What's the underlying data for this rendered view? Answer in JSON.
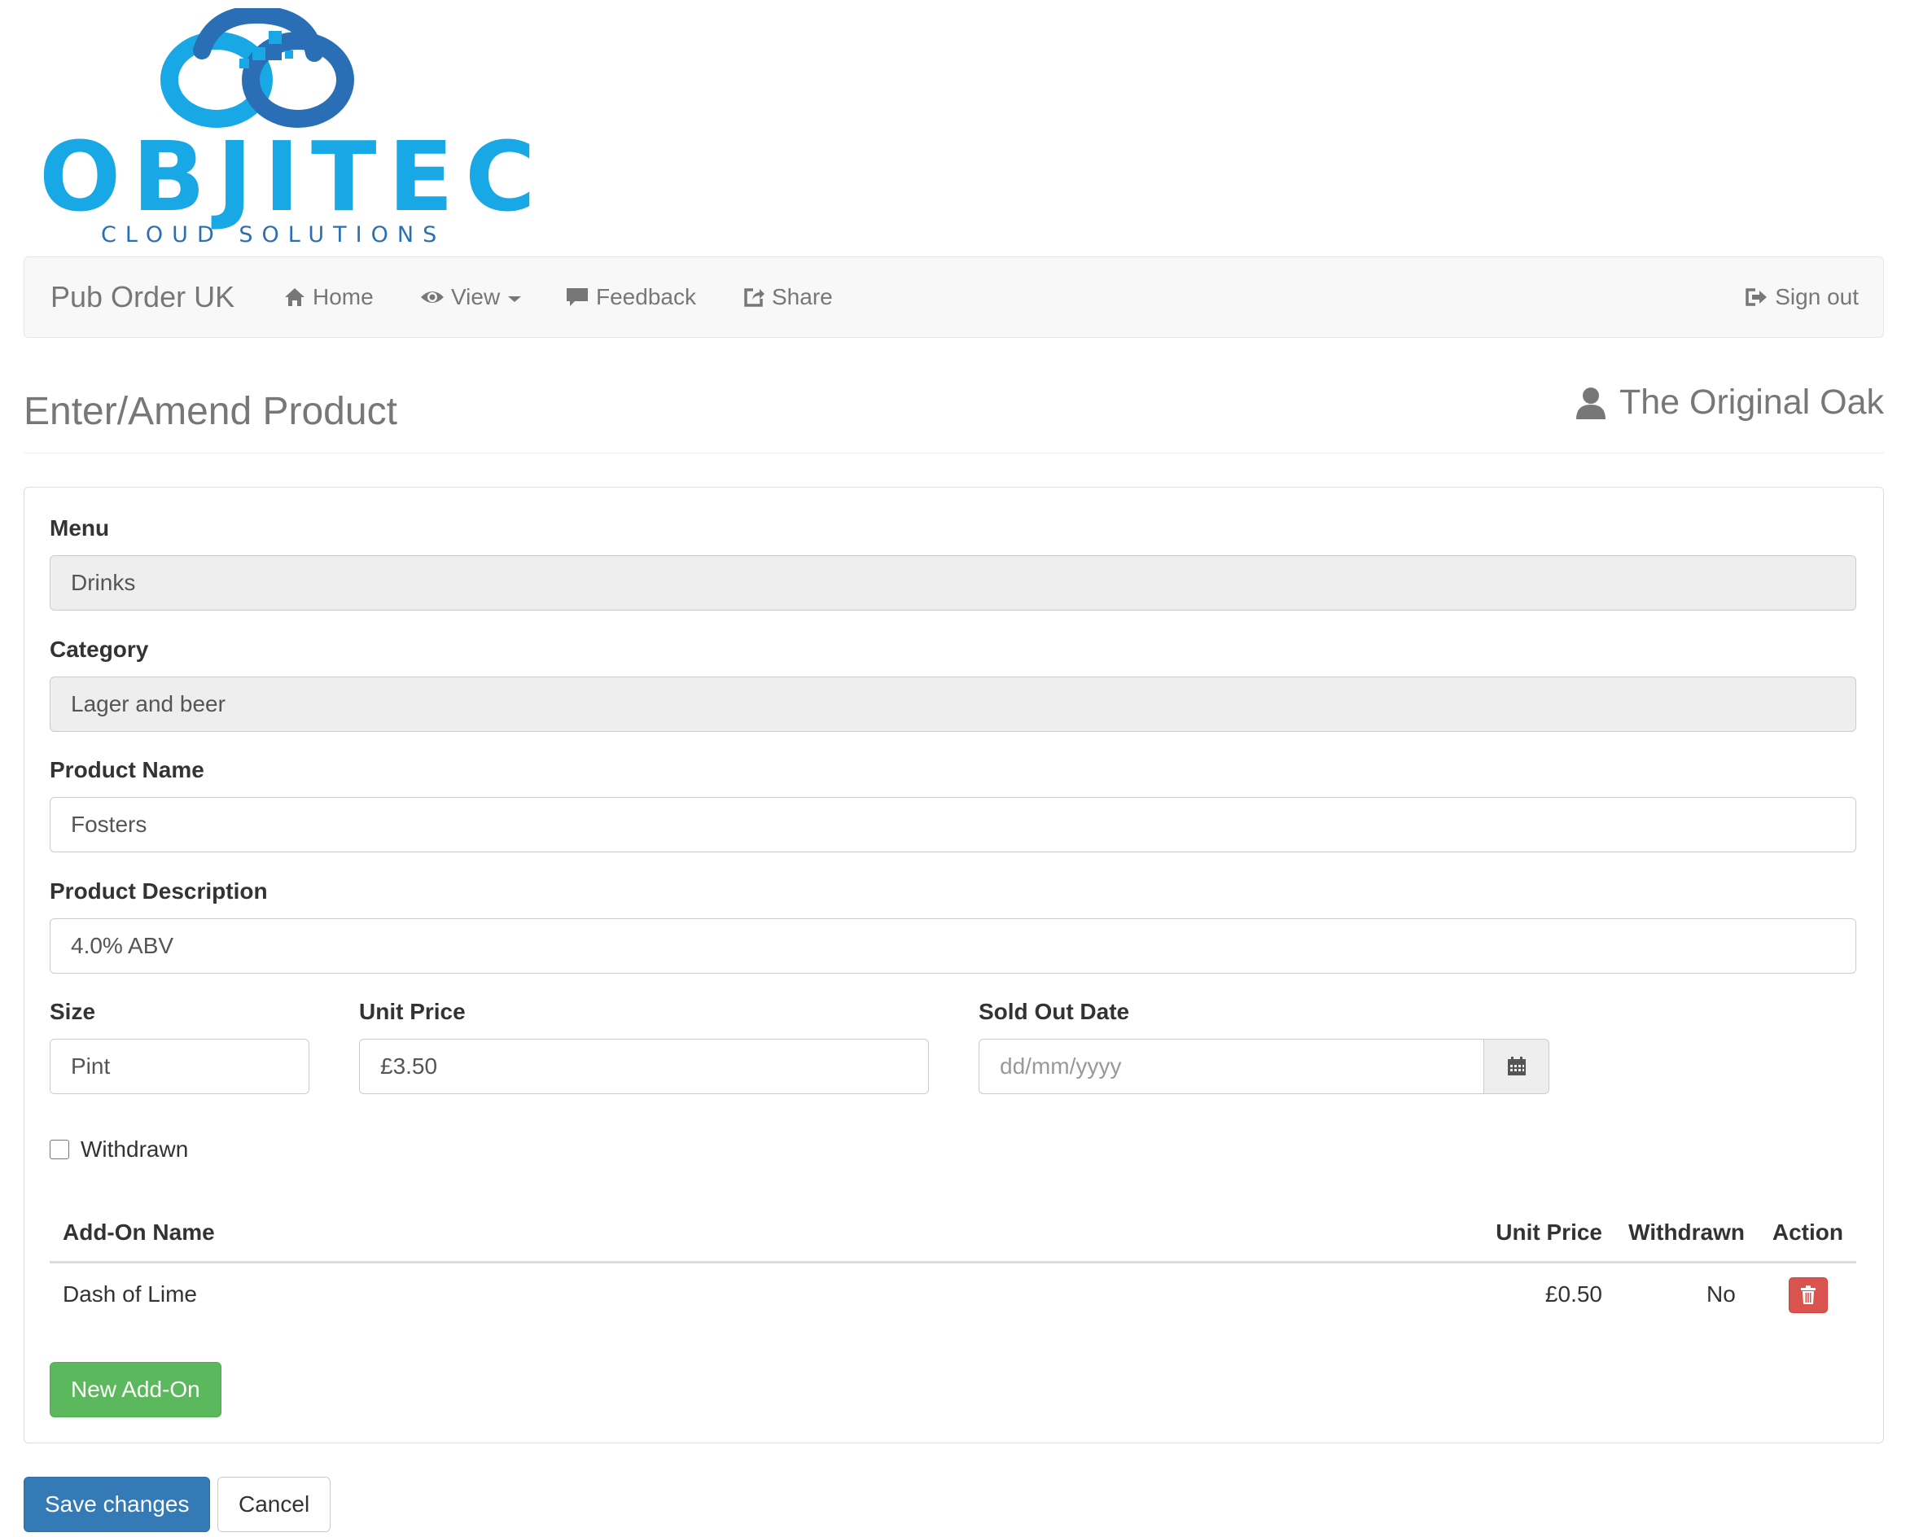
{
  "logo": {
    "wordmark": "OBJITEC",
    "tagline": "CLOUD SOLUTIONS"
  },
  "nav": {
    "brand": "Pub Order UK",
    "items": [
      {
        "label": "Home",
        "icon": "home-icon"
      },
      {
        "label": "View",
        "icon": "eye-icon"
      },
      {
        "label": "Feedback",
        "icon": "comment-icon"
      },
      {
        "label": "Share",
        "icon": "share-icon"
      }
    ],
    "signout": {
      "label": "Sign out",
      "icon": "log-out-icon"
    }
  },
  "header": {
    "title": "Enter/Amend Product",
    "user": "The Original Oak"
  },
  "form": {
    "menu": {
      "label": "Menu",
      "value": "Drinks"
    },
    "category": {
      "label": "Category",
      "value": "Lager and beer"
    },
    "product_name": {
      "label": "Product Name",
      "value": "Fosters"
    },
    "product_description": {
      "label": "Product Description",
      "value": "4.0% ABV"
    },
    "size": {
      "label": "Size",
      "value": "Pint"
    },
    "unit_price": {
      "label": "Unit Price",
      "value": "£3.50"
    },
    "sold_out_date": {
      "label": "Sold Out Date",
      "value": "",
      "placeholder": "dd/mm/yyyy"
    },
    "withdrawn": {
      "label": "Withdrawn",
      "checked": false
    }
  },
  "addons": {
    "columns": [
      "Add-On Name",
      "Unit Price",
      "Withdrawn",
      "Action"
    ],
    "rows": [
      {
        "name": "Dash of Lime",
        "unit_price": "£0.50",
        "withdrawn": "No"
      }
    ],
    "new_button": "New Add-On"
  },
  "actions": {
    "save": "Save changes",
    "cancel": "Cancel"
  },
  "colors": {
    "logo_blue": "#18a8e6",
    "logo_dark_blue": "#2a6fb5",
    "primary": "#337ab7",
    "success": "#5cb85c",
    "danger": "#d9534f"
  }
}
